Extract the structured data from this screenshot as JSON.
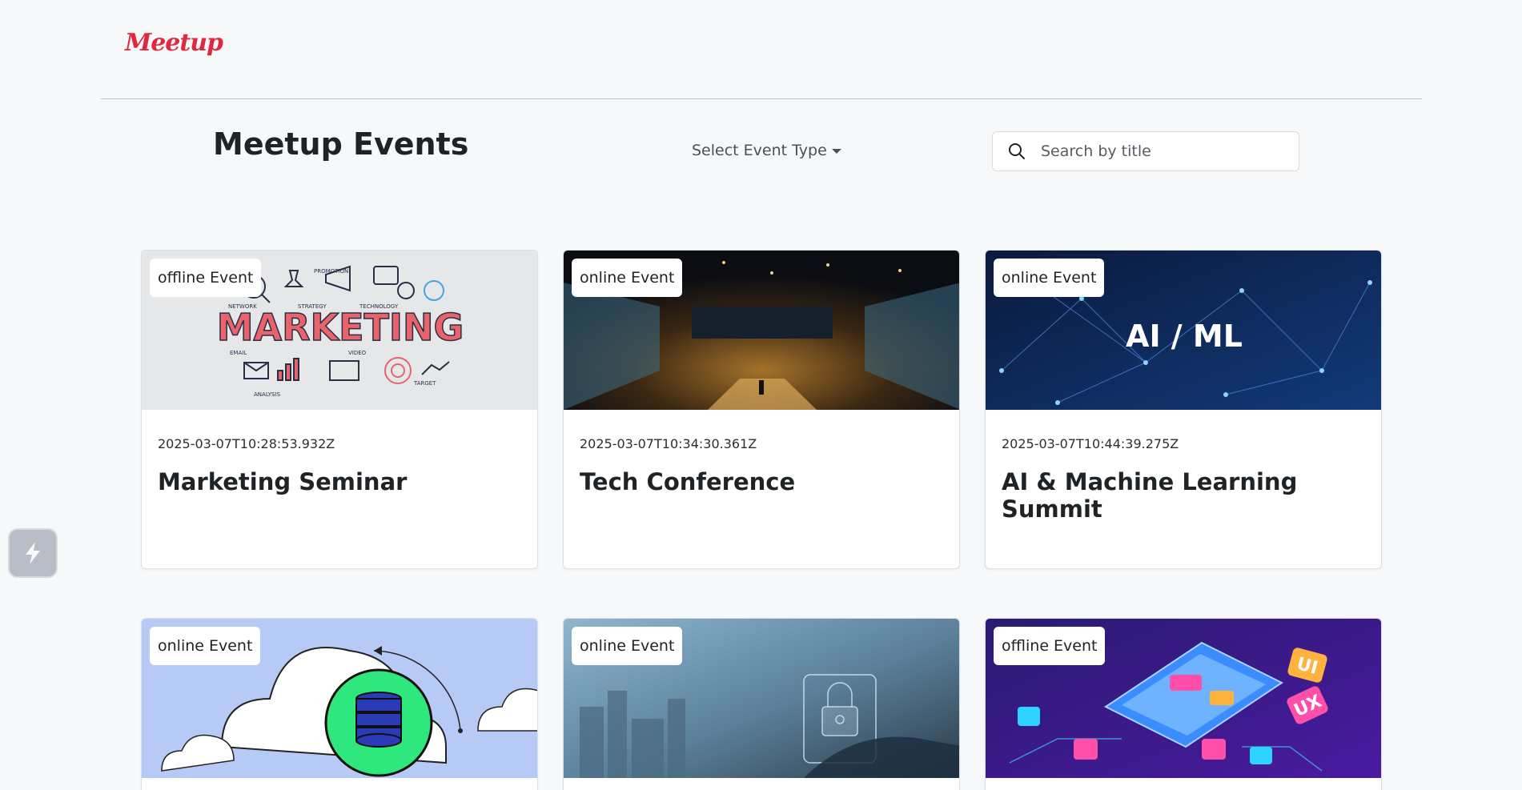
{
  "header": {
    "logo_text": "Meetup",
    "brand_color": "#e0283f"
  },
  "toolbar": {
    "title": "Meetup Events",
    "type_select_label": "Select Event Type",
    "search_placeholder": "Search by title"
  },
  "events": [
    {
      "badge": "offline Event",
      "date": "2025-03-07T10:28:53.932Z",
      "title": "Marketing Seminar",
      "image": "marketing-illustration"
    },
    {
      "badge": "online Event",
      "date": "2025-03-07T10:34:30.361Z",
      "title": "Tech Conference",
      "image": "conference-hall-photo"
    },
    {
      "badge": "online Event",
      "date": "2025-03-07T10:44:39.275Z",
      "title": "AI & Machine Learning Summit",
      "image": "ai-ml-network-graphic",
      "image_text": "AI / ML"
    },
    {
      "badge": "online Event",
      "image": "cloud-database-illustration"
    },
    {
      "badge": "online Event",
      "image": "cybersecurity-photo"
    },
    {
      "badge": "offline Event",
      "image": "ui-ux-isometric-illustration",
      "image_text_1": "UI",
      "image_text_2": "UX"
    }
  ],
  "marketing_image_text": {
    "main": "MARKETING",
    "labels": [
      "PROMOTION",
      "NETWORK",
      "STRATEGY",
      "TECHNOLOGY",
      "EMAIL",
      "VIDEO",
      "ANALYSIS",
      "TARGET"
    ]
  }
}
